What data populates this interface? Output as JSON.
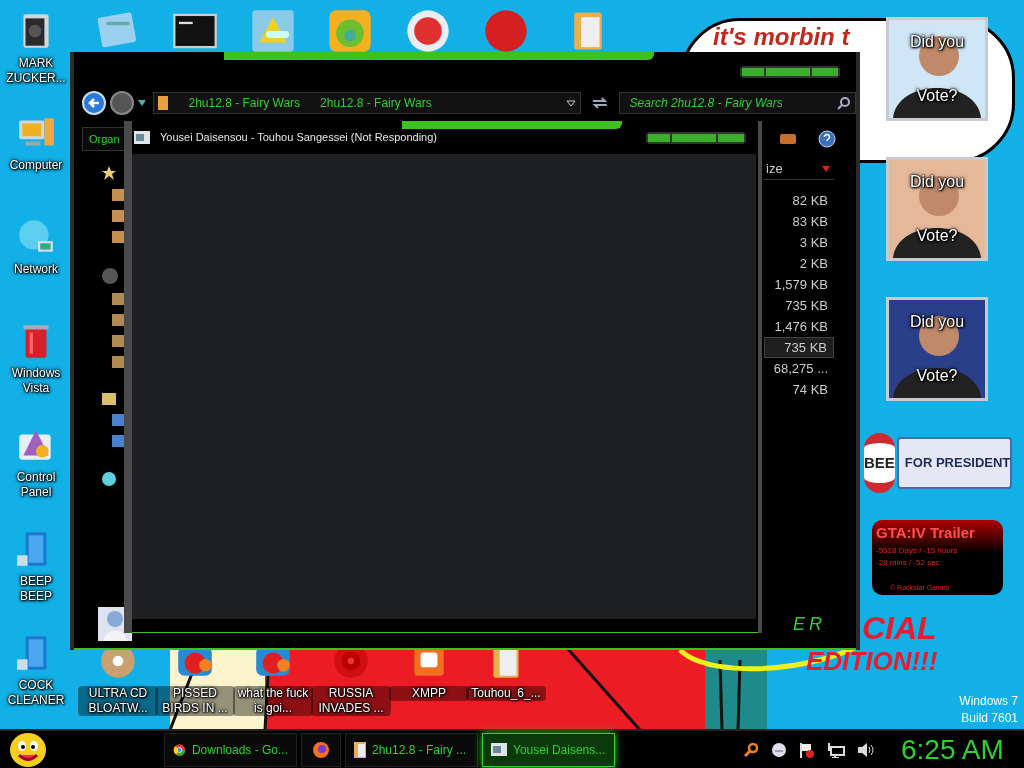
{
  "desktop": {
    "left_icons": [
      {
        "label": "MARK ZUCKER..."
      },
      {
        "label": "Computer"
      },
      {
        "label": "Network"
      },
      {
        "label": "Windows Vista"
      },
      {
        "label": "Control Panel"
      },
      {
        "label": "BEEP BEEP"
      },
      {
        "label": "COCK CLEANER"
      }
    ],
    "bottom_icons": [
      {
        "label": "ULTRA CD BLOATW..."
      },
      {
        "label": "PISSED BIRDS IN ..."
      },
      {
        "label": "what the fuck is goi..."
      },
      {
        "label": "RUSSIA INVADES ..."
      },
      {
        "label": "XMPP"
      },
      {
        "label": "Touhou_6_..."
      }
    ],
    "wallpaper_text": [
      "CIAL",
      "EDITION!!!"
    ],
    "os_version": [
      "Windows 7",
      "Build 7601"
    ]
  },
  "gadgets": {
    "speech_bubble": "it's morbin t",
    "vote_cards": [
      {
        "top": "Did you",
        "bottom": "Vote?"
      },
      {
        "top": "Did you",
        "bottom": "Vote?"
      },
      {
        "top": "Did you",
        "bottom": "Vote?"
      }
    ],
    "campaign_badge": {
      "name": "BEE",
      "slogan": "FOR PRESIDENT"
    },
    "countdown": {
      "title": "GTA:IV Trailer",
      "lines": [
        "-5518 Days / -15 hours",
        "-28 mins / -52 sec"
      ],
      "credit": "© Rockstar Games"
    }
  },
  "explorer": {
    "breadcrumbs": [
      "2hu12.8 - Fairy Wars",
      "2hu12.8 - Fairy Wars"
    ],
    "search": {
      "placeholder": "Search 2hu12.8 - Fairy Wars"
    },
    "organize": "Organ",
    "size_header": "ize",
    "sizes": [
      {
        "text": "82 KB",
        "selected": false
      },
      {
        "text": "83 KB",
        "selected": false
      },
      {
        "text": "3 KB",
        "selected": false
      },
      {
        "text": "2 KB",
        "selected": false
      },
      {
        "text": "1,579 KB",
        "selected": false
      },
      {
        "text": "735 KB",
        "selected": false
      },
      {
        "text": "1,476 KB",
        "selected": false
      },
      {
        "text": "735 KB",
        "selected": true
      },
      {
        "text": "68,275 ...",
        "selected": false
      },
      {
        "text": "74 KB",
        "selected": false
      }
    ],
    "logo": "ER"
  },
  "app_window": {
    "title": "Yousei Daisensou - Touhou Sangessei (Not Responding)"
  },
  "taskbar": {
    "items": [
      {
        "kind": "task",
        "label": "Downloads - Go...",
        "selected": false
      },
      {
        "kind": "pinned",
        "selected": false
      },
      {
        "kind": "task",
        "label": "2hu12.8 - Fairy ...",
        "selected": false
      },
      {
        "kind": "task",
        "label": "Yousei Daisens...",
        "selected": true
      }
    ],
    "clock": "6:25 AM"
  }
}
